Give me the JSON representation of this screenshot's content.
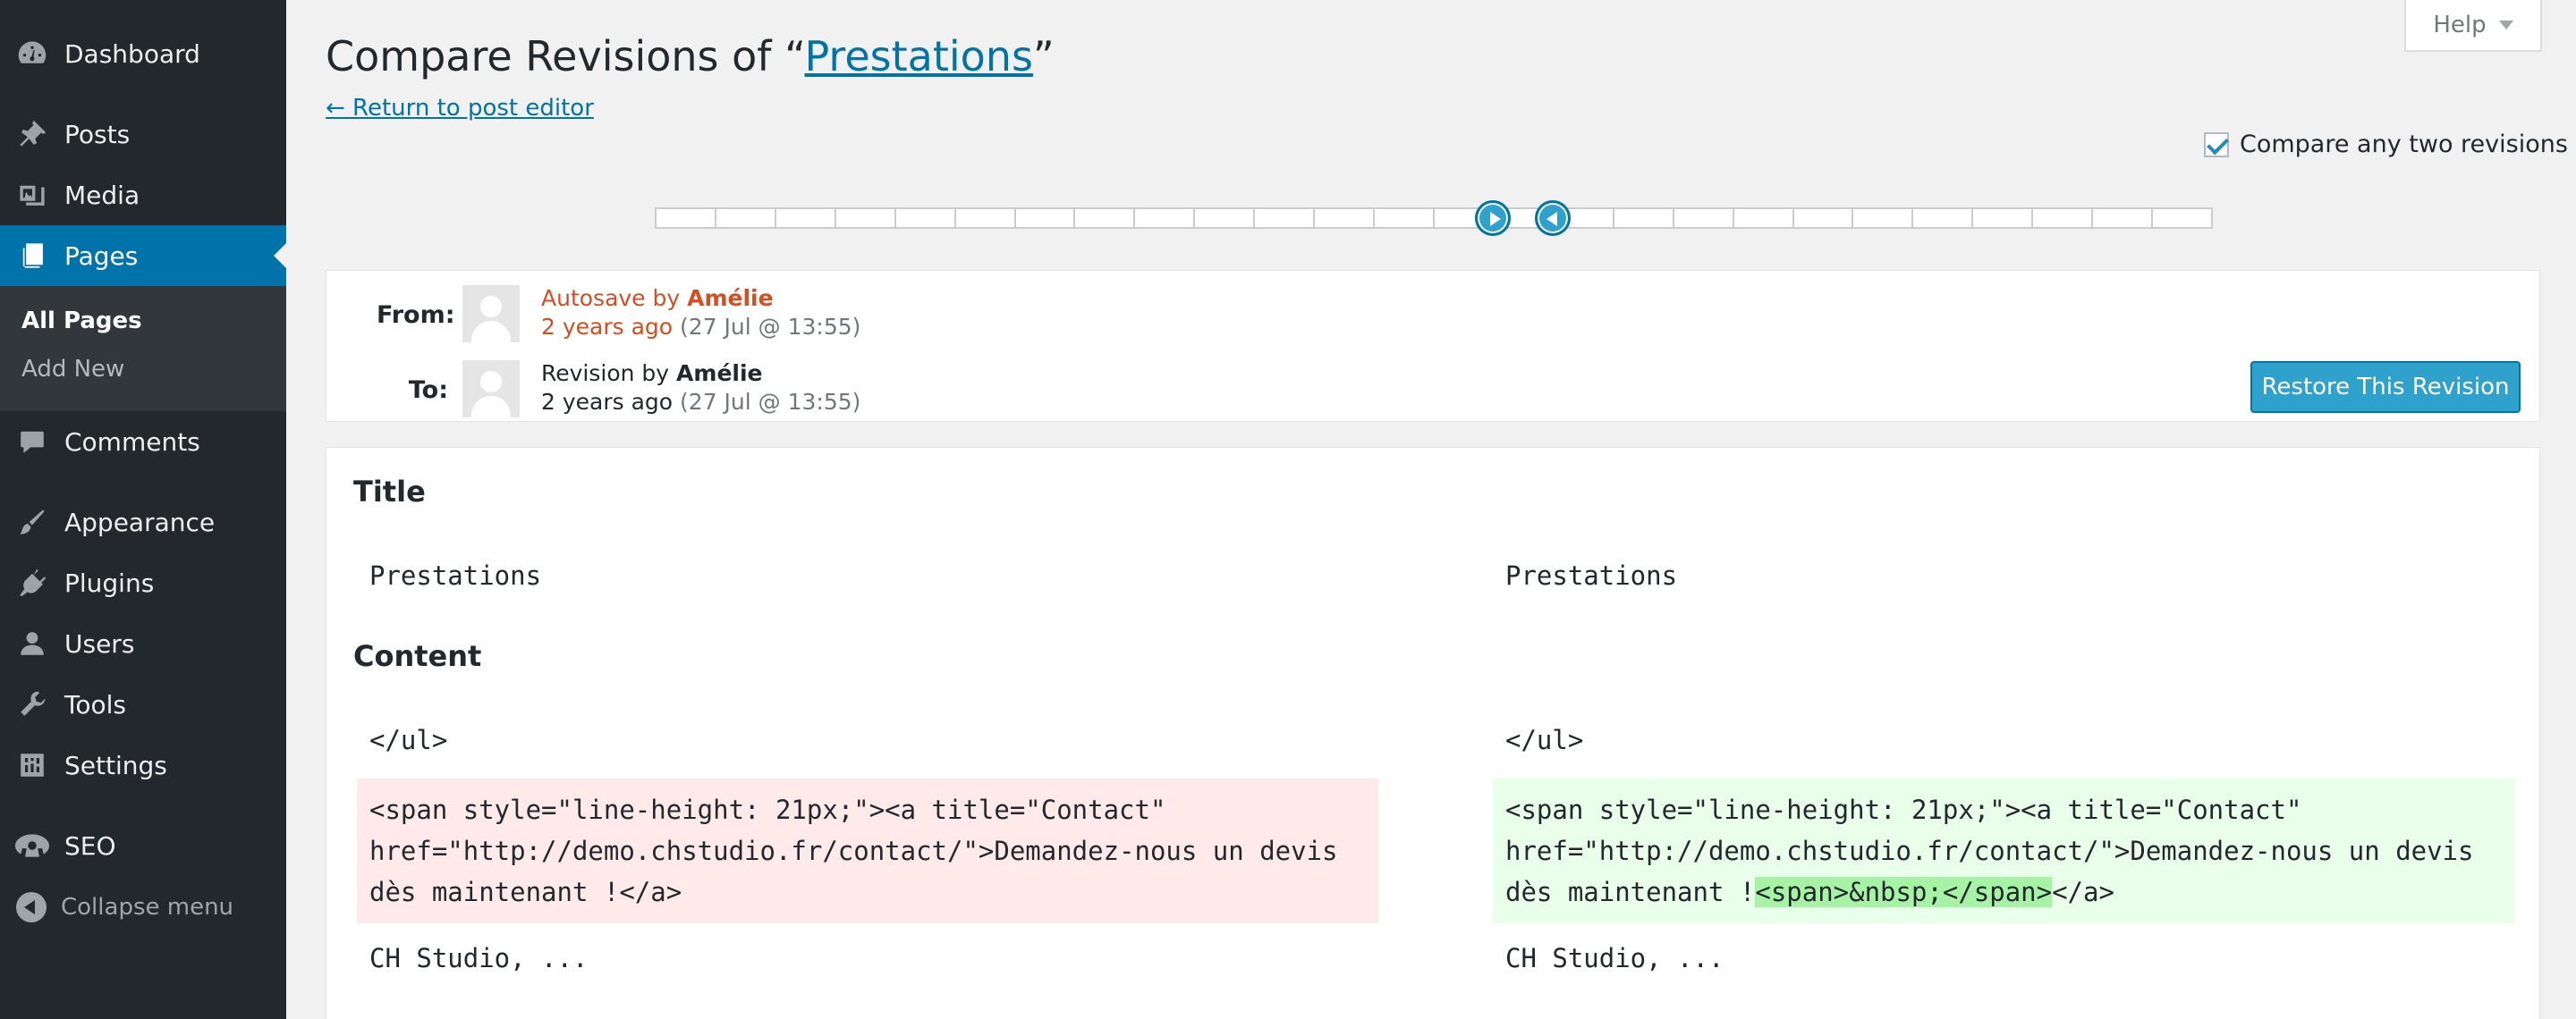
{
  "sidebar": {
    "items": [
      {
        "label": "Dashboard",
        "icon": "dashboard-icon"
      },
      {
        "label": "Posts",
        "icon": "pin-icon"
      },
      {
        "label": "Media",
        "icon": "media-icon"
      },
      {
        "label": "Pages",
        "icon": "pages-icon"
      },
      {
        "label": "Comments",
        "icon": "comment-icon"
      },
      {
        "label": "Appearance",
        "icon": "brush-icon"
      },
      {
        "label": "Plugins",
        "icon": "plug-icon"
      },
      {
        "label": "Users",
        "icon": "user-icon"
      },
      {
        "label": "Tools",
        "icon": "wrench-icon"
      },
      {
        "label": "Settings",
        "icon": "settings-icon"
      },
      {
        "label": "SEO",
        "icon": "seo-icon"
      }
    ],
    "submenu": [
      {
        "label": "All Pages"
      },
      {
        "label": "Add New"
      }
    ],
    "collapse_label": "Collapse menu"
  },
  "help": {
    "label": "Help"
  },
  "heading": {
    "prefix": "Compare Revisions of “",
    "post_title": "Prestations",
    "suffix": "”"
  },
  "return_link": "← Return to post editor",
  "compare_two": {
    "label": "Compare any two revisions",
    "checked": true
  },
  "revisions": {
    "count": 26,
    "from_index": 14,
    "to_index": 15
  },
  "from": {
    "label": "From:",
    "type": "Autosave by ",
    "author": "Amélie",
    "ago": "2 years ago",
    "date": " (27 Jul @ 13:55)"
  },
  "to": {
    "label": "To:",
    "type": "Revision by ",
    "author": "Amélie",
    "ago": "2 years ago",
    "date": " (27 Jul @ 13:55)"
  },
  "restore_button": "Restore This Revision",
  "diff": {
    "title_heading": "Title",
    "title_left": "Prestations",
    "title_right": "Prestations",
    "content_heading": "Content",
    "context_before": "</ul>",
    "left_lines": [
      "<span style=\"line-height: 21px;\"><a title=\"Contact\"",
      "href=\"http://demo.chstudio.fr/contact/\">Demandez-nous un devis",
      "dès maintenant !</a>"
    ],
    "right_lines": [
      "<span style=\"line-height: 21px;\"><a title=\"Contact\"",
      "href=\"http://demo.chstudio.fr/contact/\">Demandez-nous un devis"
    ],
    "right_line3_pre": "dès maintenant !",
    "right_line3_ins": "<span>&nbsp;</span>",
    "right_line3_post": "</a>",
    "context_after": "CH Studio, ..."
  }
}
